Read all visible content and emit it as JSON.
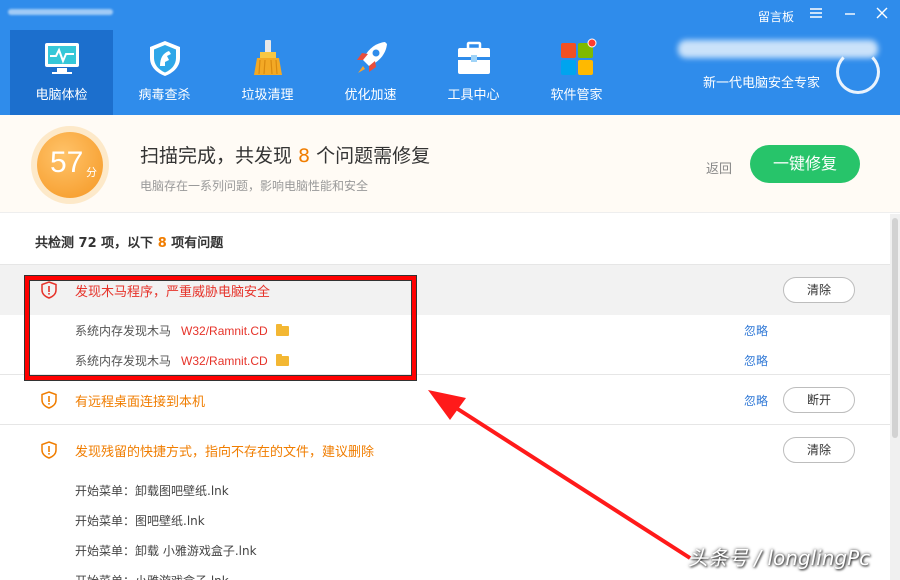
{
  "window": {
    "message_board": "留言板",
    "menu_icon": "menu-icon",
    "minimize_icon": "minimize-icon",
    "close_icon": "close-icon"
  },
  "nav": [
    {
      "label": "电脑体检",
      "icon": "monitor-pulse-icon",
      "active": true
    },
    {
      "label": "病毒查杀",
      "icon": "shield-horse-icon",
      "active": false
    },
    {
      "label": "垃圾清理",
      "icon": "broom-icon",
      "active": false
    },
    {
      "label": "优化加速",
      "icon": "rocket-icon",
      "active": false
    },
    {
      "label": "工具中心",
      "icon": "toolbox-icon",
      "active": false
    },
    {
      "label": "软件管家",
      "icon": "apps-grid-icon",
      "active": false
    }
  ],
  "header": {
    "slogan": "新一代电脑安全专家"
  },
  "summary": {
    "score": "57",
    "score_unit": "分",
    "title_prefix": "扫描完成，共发现",
    "issue_count": "8",
    "title_suffix": "个问题需修复",
    "subtitle": "电脑存在一系列问题，影响电脑性能和安全",
    "back_label": "返回",
    "fix_label": "一键修复"
  },
  "stats": {
    "prefix": "共检测",
    "total": "72",
    "middle": "项，以下",
    "count": "8",
    "suffix": "项有问题"
  },
  "groups": {
    "trojan": {
      "title": "发现木马程序，严重威胁电脑安全",
      "action": "清除",
      "items": [
        {
          "label": "系统内存发现木马",
          "name": "W32/Ramnit.CD",
          "ignore": "忽略"
        },
        {
          "label": "系统内存发现木马",
          "name": "W32/Ramnit.CD",
          "ignore": "忽略"
        }
      ]
    },
    "remote": {
      "title": "有远程桌面连接到本机",
      "ignore": "忽略",
      "action": "断开"
    },
    "shortcut": {
      "title": "发现残留的快捷方式，指向不存在的文件，建议删除",
      "action": "清除",
      "items": [
        "开始菜单：卸载图吧壁纸.lnk",
        "开始菜单：图吧壁纸.lnk",
        "开始菜单：卸载 小雅游戏盒子.lnk",
        "开始菜单：小雅游戏盒子.lnk"
      ]
    }
  },
  "colors": {
    "header_blue": "#2f8ceb",
    "active_tab": "#1c6fcd",
    "accent_orange": "#f07d00",
    "danger_red": "#e6332a",
    "fix_green": "#27c46a",
    "link_blue": "#2f78d6"
  },
  "watermark": "头条号 / longlingPc"
}
